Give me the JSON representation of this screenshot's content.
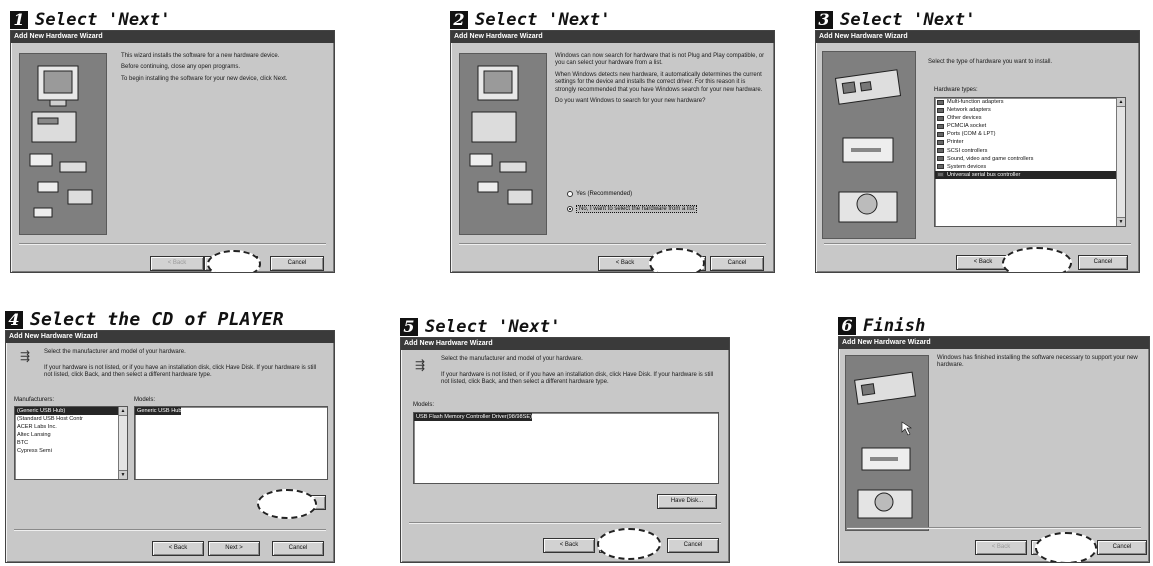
{
  "window_title": "Add New Hardware Wizard",
  "buttons": {
    "back": "< Back",
    "next": "Next >",
    "cancel": "Cancel",
    "have_disk": "Have Disk..."
  },
  "steps": [
    {
      "number": "1",
      "label": "Select 'Next'",
      "paragraphs": [
        "This wizard installs the software for a new hardware device.",
        "Before continuing, close any open programs.",
        "To begin installing the software for your new device, click Next."
      ]
    },
    {
      "number": "2",
      "label": "Select 'Next'",
      "paragraphs": [
        "Windows can now search for hardware that is not Plug and Play compatible, or you can select your hardware from a list.",
        "When Windows detects new hardware, it automatically determines the current settings for the device and installs the correct driver. For this reason it is strongly recommended that you have Windows search for your new hardware.",
        "Do you want Windows to search for your new hardware?"
      ],
      "radio_yes": "Yes (Recommended)",
      "radio_no": "No, I want to select the hardware from a list"
    },
    {
      "number": "3",
      "label": "Select 'Next'",
      "instruction": "Select the type of hardware you want to install.",
      "list_label": "Hardware types:",
      "hardware_types": [
        "Multi-function adapters",
        "Network adapters",
        "Other devices",
        "PCMCIA socket",
        "Ports (COM & LPT)",
        "Printer",
        "SCSI controllers",
        "Sound, video and game controllers",
        "System devices",
        "Universal serial bus controller"
      ],
      "selected_index": 9
    },
    {
      "number": "4",
      "label": "Select  the CD of PLAYER",
      "instruction": "Select the manufacturer and model of your hardware.",
      "info": "If your hardware is not listed, or if you have an installation disk, click Have Disk. If your hardware is still not listed, click Back, and then select a different hardware type.",
      "manufacturers_label": "Manufacturers:",
      "models_label": "Models:",
      "manufacturers": [
        "(Generic USB Hub)",
        "(Standard USB Host Contr",
        "ACER Labs Inc.",
        "Altec Lansing",
        "BTC",
        "Cypress Semi"
      ],
      "models": [
        "Generic USB Hub"
      ]
    },
    {
      "number": "5",
      "label": "Select 'Next'",
      "instruction": "Select the manufacturer and model of your hardware.",
      "info": "If your hardware is not listed, or if you have an installation disk, click Have Disk. If your hardware is still not listed, click Back, and then select a different hardware type.",
      "models_label": "Models:",
      "models": [
        "USB Flash Memory Controller Driver(98/98SE)"
      ]
    },
    {
      "number": "6",
      "label": "Finish",
      "message": "Windows has finished installing the software necessary to support your new hardware."
    }
  ]
}
